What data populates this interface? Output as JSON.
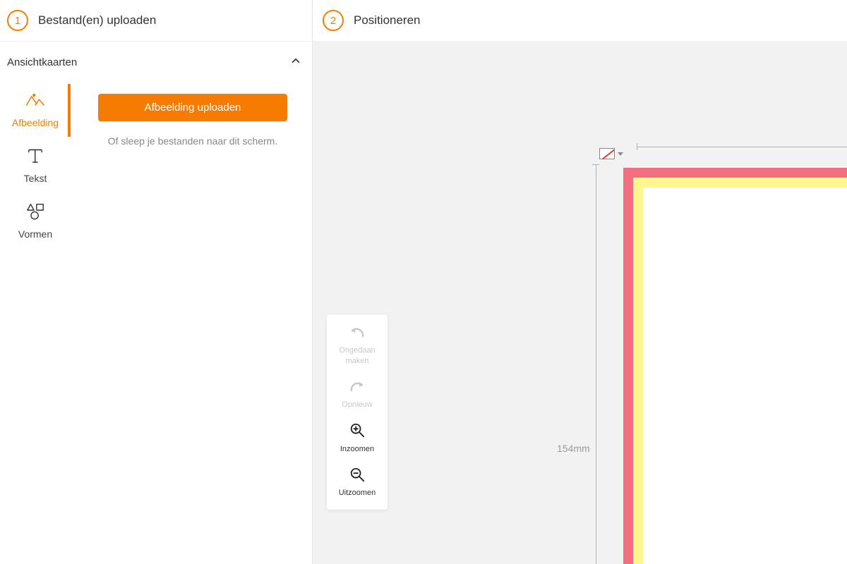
{
  "step1": {
    "number": "1",
    "title": "Bestand(en) uploaden"
  },
  "step2": {
    "number": "2",
    "title": "Positioneren"
  },
  "accordion": {
    "title": "Ansichtkaarten"
  },
  "tabs": {
    "image": "Afbeelding",
    "text": "Tekst",
    "shapes": "Vormen"
  },
  "upload": {
    "button": "Afbeelding uploaden",
    "hint": "Of sleep je bestanden naar dit scherm."
  },
  "tools": {
    "undo": "Ongedaan maken",
    "redo": "Opnieuw",
    "zoomin": "Inzoomen",
    "zoomout": "Uitzoomen"
  },
  "ruler": {
    "height_label": "154mm"
  }
}
